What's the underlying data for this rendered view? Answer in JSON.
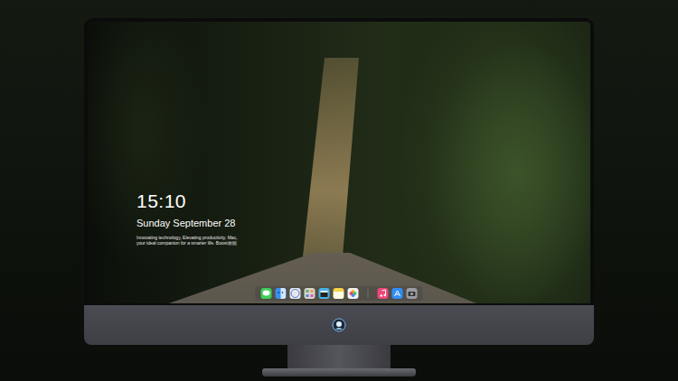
{
  "lockscreen": {
    "time": "15:10",
    "date": "Sunday September 28",
    "tagline": [
      "Innovating technology, Elevating productivity. Mac,",
      "your ideal companion for a smarter life. Boost效能"
    ]
  },
  "dock": [
    {
      "kind": "messages",
      "color": "#3ecf5a"
    },
    {
      "kind": "finder",
      "color": "#3a8ef0"
    },
    {
      "kind": "safari",
      "color": "#e9e9ee"
    },
    {
      "kind": "grid",
      "color": "#d9d6c8"
    },
    {
      "kind": "clapper",
      "color": "#46b3e6"
    },
    {
      "kind": "notes",
      "color": "#f6d34a"
    },
    {
      "kind": "photos",
      "color": "#f2f2f2"
    },
    {
      "kind": "separator",
      "color": "#8a8a8a"
    },
    {
      "kind": "music",
      "color": "#f0477a"
    },
    {
      "kind": "appstore",
      "color": "#2f8ff7"
    },
    {
      "kind": "camera",
      "color": "#9c9ca4"
    }
  ]
}
